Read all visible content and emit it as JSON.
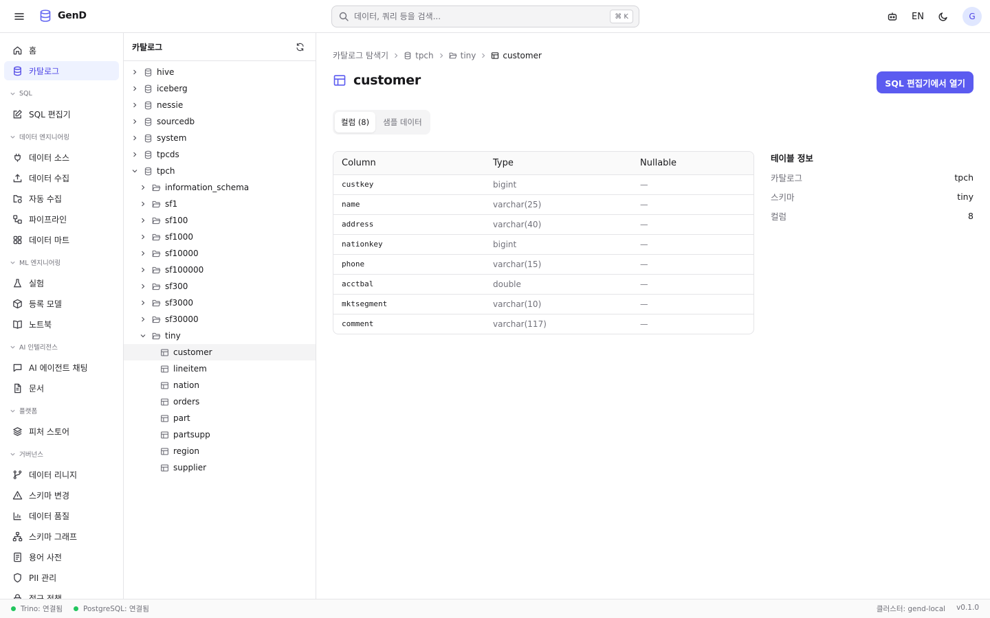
{
  "app": {
    "name": "GenD",
    "brand_color": "#5b5bf0"
  },
  "search": {
    "placeholder": "데이터, 쿼리 등을 검색...",
    "shortcut": "⌘ K"
  },
  "topbar": {
    "language": "EN",
    "avatar_initial": "G",
    "icons": [
      "bot-icon",
      "moon-icon"
    ]
  },
  "sidebar": {
    "top_items": [
      {
        "label": "홈",
        "icon": "home-icon"
      },
      {
        "label": "카탈로그",
        "icon": "database-icon",
        "active": true
      }
    ],
    "groups": [
      {
        "label": "SQL",
        "items": [
          {
            "label": "SQL 편집기",
            "icon": "edit-icon"
          }
        ]
      },
      {
        "label": "데이터 엔지니어링",
        "items": [
          {
            "label": "데이터 소스",
            "icon": "plug-icon"
          },
          {
            "label": "데이터 수집",
            "icon": "upload-icon"
          },
          {
            "label": "자동 수집",
            "icon": "folder-sync-icon"
          },
          {
            "label": "파이프라인",
            "icon": "workflow-icon"
          },
          {
            "label": "데이터 마트",
            "icon": "grid-icon"
          }
        ]
      },
      {
        "label": "ML 엔지니어링",
        "items": [
          {
            "label": "실험",
            "icon": "flask-icon"
          },
          {
            "label": "등록 모델",
            "icon": "box-icon"
          },
          {
            "label": "노트북",
            "icon": "book-icon"
          }
        ]
      },
      {
        "label": "AI 인텔리전스",
        "items": [
          {
            "label": "AI 에이전트 채팅",
            "icon": "chat-icon"
          },
          {
            "label": "문서",
            "icon": "file-icon"
          }
        ]
      },
      {
        "label": "플랫폼",
        "items": [
          {
            "label": "피처 스토어",
            "icon": "layers-icon"
          }
        ]
      },
      {
        "label": "거버넌스",
        "items": [
          {
            "label": "데이터 리니지",
            "icon": "git-branch-icon"
          },
          {
            "label": "스키마 변경",
            "icon": "alert-icon"
          },
          {
            "label": "데이터 품질",
            "icon": "bar-chart-icon"
          },
          {
            "label": "스키마 그래프",
            "icon": "network-icon"
          },
          {
            "label": "용어 사전",
            "icon": "book-text-icon"
          },
          {
            "label": "PII 관리",
            "icon": "shield-icon"
          },
          {
            "label": "접근 정책",
            "icon": "lock-icon"
          }
        ]
      }
    ]
  },
  "catalog_tree": {
    "title": "카탈로그",
    "catalogs": [
      "hive",
      "iceberg",
      "nessie",
      "sourcedb",
      "system",
      "tpcds"
    ],
    "expanded_catalog": "tpch",
    "schemas": [
      "information_schema",
      "sf1",
      "sf100",
      "sf1000",
      "sf10000",
      "sf100000",
      "sf300",
      "sf3000",
      "sf30000"
    ],
    "expanded_schema": "tiny",
    "tables": [
      "customer",
      "lineitem",
      "nation",
      "orders",
      "part",
      "partsupp",
      "region",
      "supplier"
    ],
    "selected_table": "customer"
  },
  "breadcrumb": {
    "root": "카탈로그 탐색기",
    "catalog": "tpch",
    "schema": "tiny",
    "table": "customer"
  },
  "page": {
    "title": "customer",
    "open_button": "SQL 편집기에서 열기"
  },
  "tabs": [
    {
      "label": "컬럼 (8)",
      "active": true
    },
    {
      "label": "샘플 데이터",
      "active": false
    }
  ],
  "columns_table": {
    "headers": [
      "Column",
      "Type",
      "Nullable"
    ],
    "rows": [
      [
        "custkey",
        "bigint",
        "—"
      ],
      [
        "name",
        "varchar(25)",
        "—"
      ],
      [
        "address",
        "varchar(40)",
        "—"
      ],
      [
        "nationkey",
        "bigint",
        "—"
      ],
      [
        "phone",
        "varchar(15)",
        "—"
      ],
      [
        "acctbal",
        "double",
        "—"
      ],
      [
        "mktsegment",
        "varchar(10)",
        "—"
      ],
      [
        "comment",
        "varchar(117)",
        "—"
      ]
    ]
  },
  "table_info": {
    "title": "테이블 정보",
    "rows": [
      {
        "key": "카탈로그",
        "value": "tpch"
      },
      {
        "key": "스키마",
        "value": "tiny"
      },
      {
        "key": "컬럼",
        "value": "8"
      }
    ]
  },
  "statusbar": {
    "trino": "Trino: 연결됨",
    "postgres": "PostgreSQL: 연결됨",
    "cluster": "클러스터: gend-local",
    "version": "v0.1.0",
    "ok_color": "#22c55e"
  }
}
